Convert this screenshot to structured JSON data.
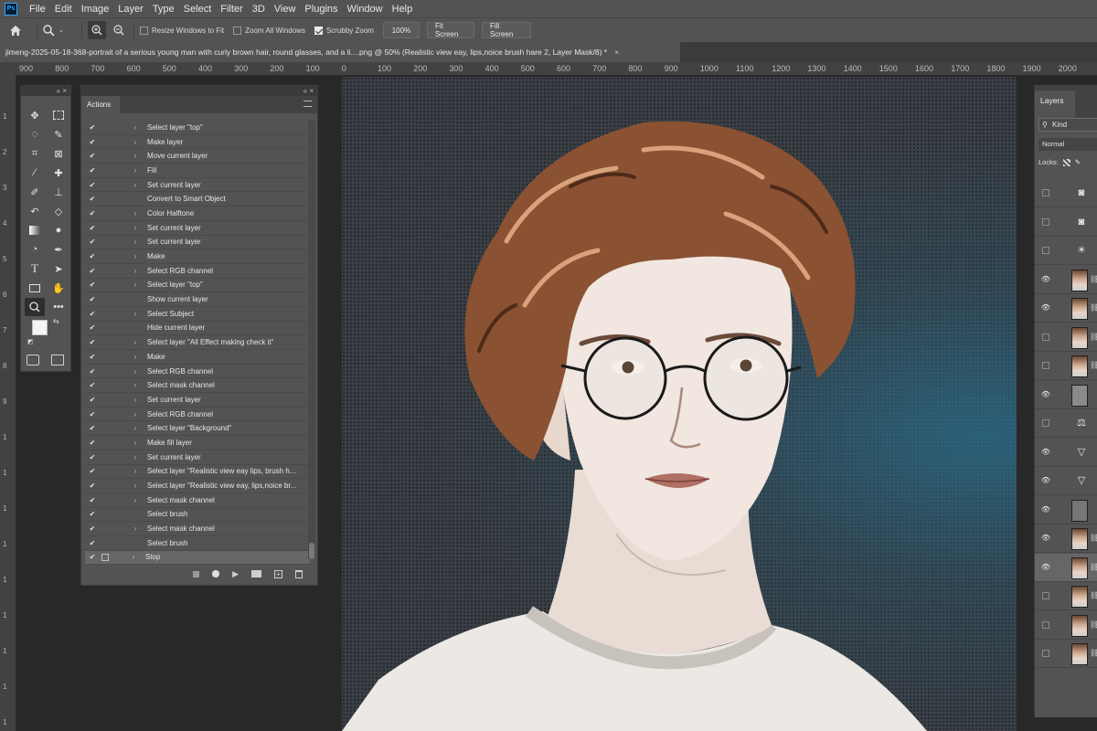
{
  "app": {
    "logo": "Ps"
  },
  "menu": [
    "File",
    "Edit",
    "Image",
    "Layer",
    "Type",
    "Select",
    "Filter",
    "3D",
    "View",
    "Plugins",
    "Window",
    "Help"
  ],
  "options": {
    "resize_windows": "Resize Windows to Fit",
    "zoom_all": "Zoom All Windows",
    "scrubby": "Scrubby Zoom",
    "zoom_value": "100%",
    "fit_screen": "Fit Screen",
    "fill_screen": "Fill Screen"
  },
  "document": {
    "tab_title": "jimeng-2025-05-18-368-portrait of a serious young man with curly brown hair, round glasses, and a li....png @ 50% (Realistic view eay, lips,noice brush hare 2, Layer Mask/8) *",
    "close": "×"
  },
  "ruler": {
    "h_labels": [
      "900",
      "800",
      "700",
      "600",
      "500",
      "400",
      "300",
      "200",
      "100",
      "0",
      "100",
      "200",
      "300",
      "400",
      "500",
      "600",
      "700",
      "800",
      "900",
      "1000",
      "1100",
      "1200",
      "1300",
      "1400",
      "1500",
      "1600",
      "1700",
      "1800",
      "1900",
      "2000"
    ],
    "v_labels": [
      "1",
      "2",
      "3",
      "4",
      "5",
      "6",
      "7",
      "8",
      "9",
      "1",
      "1",
      "1",
      "1",
      "1",
      "1",
      "1",
      "1",
      "1"
    ]
  },
  "tools_panel": {
    "collapse": "«  ×"
  },
  "actions_panel": {
    "tab": "Actions",
    "collapse": "«  ×",
    "items": [
      {
        "label": "Select layer \"top\"",
        "expand": true
      },
      {
        "label": "Make layer",
        "expand": true
      },
      {
        "label": "Move current layer",
        "expand": true
      },
      {
        "label": "Fill",
        "expand": true
      },
      {
        "label": "Set current layer",
        "expand": true
      },
      {
        "label": "Convert to Smart Object",
        "expand": false
      },
      {
        "label": "Color Halftone",
        "expand": true
      },
      {
        "label": "Set current layer",
        "expand": true
      },
      {
        "label": "Set current layer",
        "expand": true
      },
      {
        "label": "Make",
        "expand": true
      },
      {
        "label": "Select RGB channel",
        "expand": true
      },
      {
        "label": "Select layer \"top\"",
        "expand": true
      },
      {
        "label": "Show current layer",
        "expand": false
      },
      {
        "label": "Select Subject",
        "expand": true
      },
      {
        "label": "Hide current layer",
        "expand": false
      },
      {
        "label": "Select layer \"All Effect making check it\"",
        "expand": true
      },
      {
        "label": "Make",
        "expand": true
      },
      {
        "label": "Select RGB channel",
        "expand": true
      },
      {
        "label": "Select mask channel",
        "expand": true
      },
      {
        "label": "Set current layer",
        "expand": true
      },
      {
        "label": "Select RGB channel",
        "expand": true
      },
      {
        "label": "Select layer \"Background\"",
        "expand": true
      },
      {
        "label": "Make fill layer",
        "expand": true
      },
      {
        "label": "Set current layer",
        "expand": true
      },
      {
        "label": "Select layer \"Realistic view eay lips, brush h...",
        "expand": true
      },
      {
        "label": "Select layer \"Realistic view eay, lips,noice br...",
        "expand": true
      },
      {
        "label": "Select mask channel",
        "expand": true
      },
      {
        "label": "Select brush",
        "expand": false
      },
      {
        "label": "Select mask channel",
        "expand": true
      },
      {
        "label": "Select brush",
        "expand": false
      },
      {
        "label": "Stop",
        "expand": true
      }
    ],
    "footer_icons": [
      "stop-icon",
      "record-icon",
      "play-icon",
      "folder-icon",
      "new-action-icon",
      "trash-icon"
    ]
  },
  "layers_panel": {
    "tab": "Layers",
    "kind": "Kind",
    "mode": "Normal",
    "locks": "Locks:",
    "rows": [
      {
        "visible": false,
        "thumb": "camera",
        "selected": false
      },
      {
        "visible": false,
        "thumb": "camera",
        "selected": false
      },
      {
        "visible": false,
        "thumb": "sun",
        "selected": false
      },
      {
        "visible": true,
        "thumb": "photo",
        "selected": false
      },
      {
        "visible": true,
        "thumb": "photo",
        "selected": false
      },
      {
        "visible": false,
        "thumb": "photo",
        "selected": false
      },
      {
        "visible": false,
        "thumb": "photo",
        "selected": false
      },
      {
        "visible": true,
        "thumb": "gray",
        "selected": false
      },
      {
        "visible": false,
        "thumb": "balance",
        "selected": false
      },
      {
        "visible": true,
        "thumb": "triangle",
        "selected": false
      },
      {
        "visible": true,
        "thumb": "triangle",
        "selected": false
      },
      {
        "visible": true,
        "thumb": "sketch",
        "selected": false
      },
      {
        "visible": true,
        "thumb": "photo",
        "selected": false
      },
      {
        "visible": true,
        "thumb": "photo",
        "selected": true
      },
      {
        "visible": false,
        "thumb": "photo",
        "selected": false
      },
      {
        "visible": false,
        "thumb": "photo",
        "selected": false
      },
      {
        "visible": false,
        "thumb": "photo",
        "selected": false
      }
    ]
  },
  "colors": {
    "foreground": "#f4f4f4",
    "background": "#000000",
    "accent": "#31a8ff"
  }
}
